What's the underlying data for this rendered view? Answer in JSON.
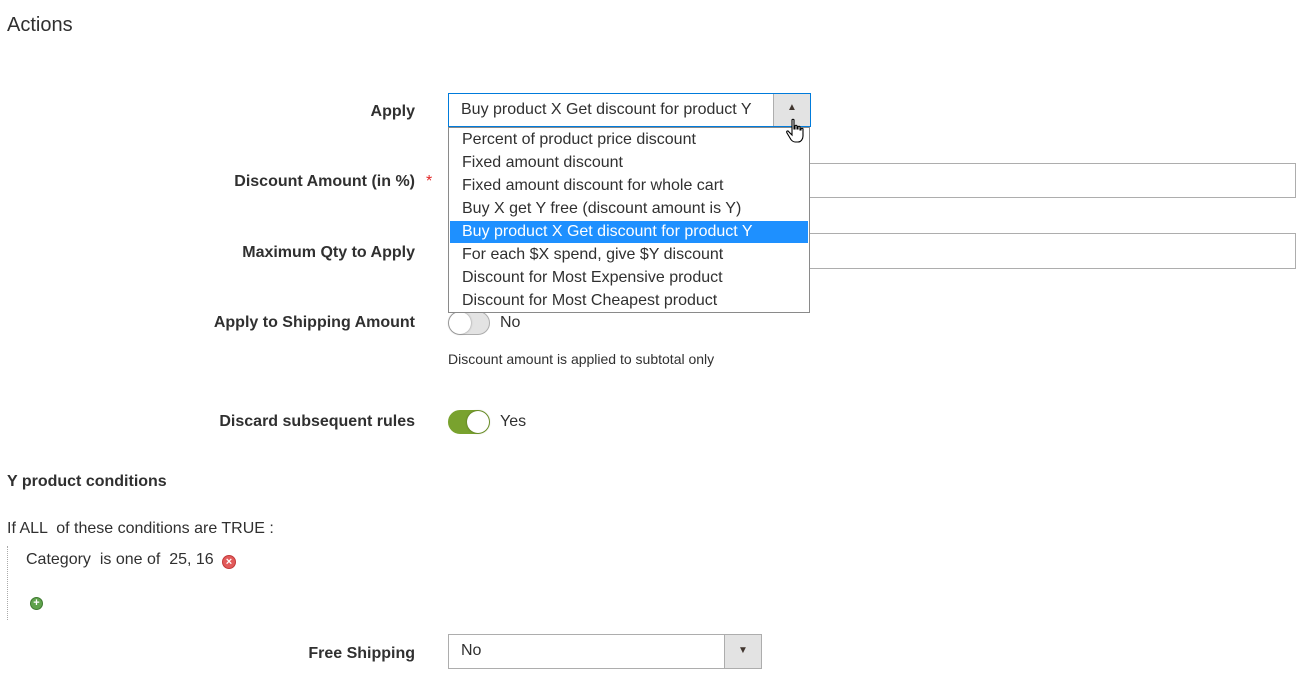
{
  "section": {
    "title": "Actions"
  },
  "apply": {
    "label": "Apply",
    "selected_value": "Buy product X Get discount for product Y",
    "options": [
      "Percent of product price discount",
      "Fixed amount discount",
      "Fixed amount discount for whole cart",
      "Buy X get Y free (discount amount is Y)",
      "Buy product X Get discount for product Y",
      "For each $X spend, give $Y discount",
      "Discount for Most Expensive product",
      "Discount for Most Cheapest product"
    ],
    "highlighted_index": 4
  },
  "discount_amount": {
    "label": "Discount Amount (in %)",
    "required_marker": "*"
  },
  "max_qty": {
    "label": "Maximum Qty to Apply"
  },
  "apply_shipping": {
    "label": "Apply to Shipping Amount",
    "state": "No",
    "note": "Discount amount is applied to subtotal only"
  },
  "discard_rules": {
    "label": "Discard subsequent rules",
    "state": "Yes"
  },
  "y_conditions": {
    "title": "Y product conditions",
    "prefix": "If",
    "aggregator": "ALL",
    "middle": " of these conditions are",
    "value": "TRUE",
    "suffix": ":",
    "item": {
      "attribute": "Category",
      "operator": "is one of",
      "value": "25, 16"
    }
  },
  "free_shipping": {
    "label": "Free Shipping",
    "value": "No"
  },
  "icons": {
    "select_open_arrow": "caret-up-icon",
    "select_closed_arrow": "caret-down-icon",
    "remove_condition": "remove-icon",
    "add_condition": "add-icon",
    "cursor": "hand-pointer-icon"
  },
  "colors": {
    "focus_border": "#007bdb",
    "option_highlight": "#1e90ff",
    "toggle_on": "#79a22e",
    "required": "#e22626"
  }
}
